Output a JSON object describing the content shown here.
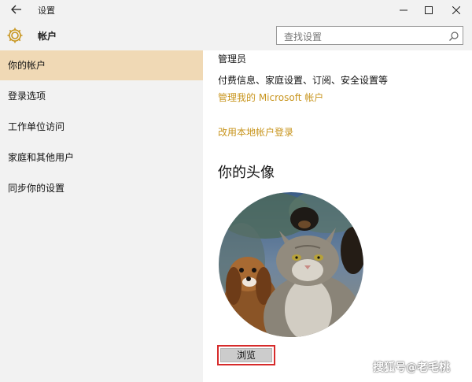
{
  "window": {
    "title": "设置",
    "back_icon": "back-arrow-icon",
    "controls": [
      "minimize-icon",
      "maximize-icon",
      "close-icon"
    ]
  },
  "header": {
    "icon": "gear-icon",
    "title": "帐户",
    "search_placeholder": "查找设置",
    "search_icon": "search-icon"
  },
  "sidebar": {
    "items": [
      {
        "label": "你的帐户",
        "active": true
      },
      {
        "label": "登录选项",
        "active": false
      },
      {
        "label": "工作单位访问",
        "active": false
      },
      {
        "label": "家庭和其他用户",
        "active": false
      },
      {
        "label": "同步你的设置",
        "active": false
      }
    ]
  },
  "main": {
    "role": "管理员",
    "info": "付费信息、家庭设置、订阅、安全设置等",
    "manage_link": "管理我的 Microsoft 帐户",
    "local_link": "改用本地帐户登录",
    "avatar_title": "你的头像",
    "browse_label": "浏览"
  },
  "watermark": "搜狐号@老毛桃",
  "colors": {
    "accent": "#c8951e",
    "active_bg": "#f0d9b5",
    "highlight_border": "#d62b2b"
  }
}
